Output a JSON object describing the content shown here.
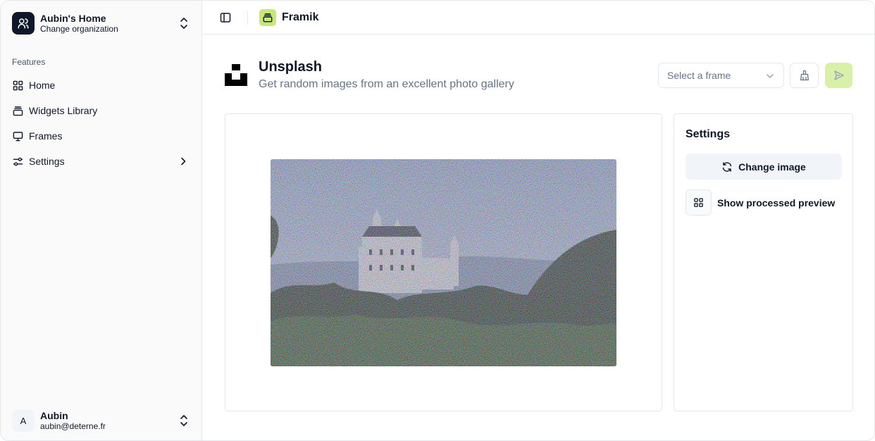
{
  "sidebar": {
    "org": {
      "name": "Aubin's Home",
      "subtitle": "Change organization",
      "icon": "users-icon"
    },
    "section_label": "Features",
    "items": [
      {
        "label": "Home",
        "icon": "layout-grid-icon"
      },
      {
        "label": "Widgets Library",
        "icon": "stack-icon"
      },
      {
        "label": "Frames",
        "icon": "monitor-icon"
      },
      {
        "label": "Settings",
        "icon": "sliders-icon"
      }
    ],
    "user": {
      "avatar_letter": "A",
      "name": "Aubin",
      "email": "aubin@deterne.fr"
    }
  },
  "header": {
    "app_name": "Framik",
    "brand_color": "#c6e879"
  },
  "widget": {
    "title": "Unsplash",
    "description": "Get random images from an excellent photo gallery",
    "frame_select": {
      "placeholder": "Select a frame"
    }
  },
  "settings": {
    "title": "Settings",
    "change_image_label": "Change image",
    "show_preview_label": "Show processed preview"
  },
  "colors": {
    "accent": "#d9f0a9",
    "text": "#0f172a",
    "muted": "#64748b"
  }
}
